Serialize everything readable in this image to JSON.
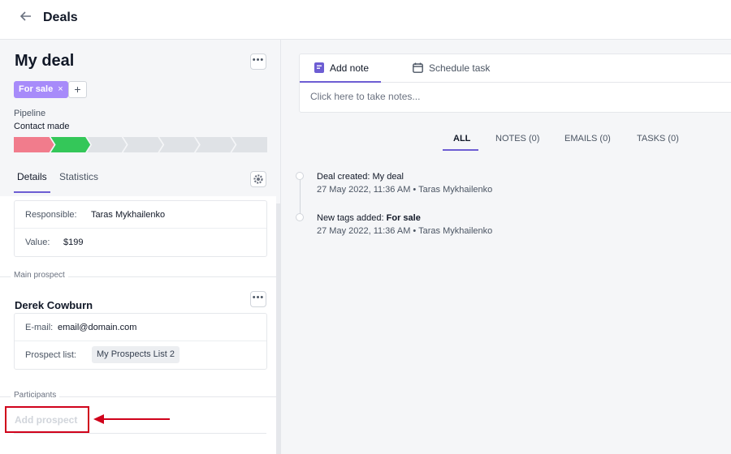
{
  "header": {
    "title": "Deals"
  },
  "deal": {
    "title": "My deal",
    "tag": "For sale",
    "tag_remove": "×",
    "tag_add": "+",
    "pipeline_label": "Pipeline",
    "pipeline_stage": "Contact made",
    "pipeline_colors": [
      "#f17c8c",
      "#34c759",
      "#dfe2e6",
      "#dfe2e6",
      "#dfe2e6",
      "#dfe2e6",
      "#dfe2e6"
    ]
  },
  "left_tabs": {
    "details": "Details",
    "statistics": "Statistics"
  },
  "details": {
    "responsible_label": "Responsible:",
    "responsible_value": "Taras Mykhailenko",
    "value_label": "Value:",
    "value_value": "$199"
  },
  "prospect": {
    "section_label": "Main prospect",
    "name": "Derek Cowburn",
    "email_label": "E-mail:",
    "email_value": "email@domain.com",
    "list_label": "Prospect list:",
    "list_value": "My Prospects List 2"
  },
  "participants": {
    "section_label": "Participants",
    "add_label": "Add prospect"
  },
  "notes": {
    "tab_note": "Add note",
    "tab_task": "Schedule task",
    "placeholder": "Click here to take notes..."
  },
  "filter_tabs": [
    "ALL",
    "NOTES (0)",
    "EMAILS (0)",
    "TASKS (0)"
  ],
  "activity": [
    {
      "title": "Deal created: My deal",
      "title_bold": "",
      "date": "27 May 2022, 11:36 AM",
      "author": "Taras Mykhailenko"
    },
    {
      "title": "New tags added: ",
      "title_bold": "For sale",
      "date": "27 May 2022, 11:36 AM",
      "author": "Taras Mykhailenko"
    }
  ],
  "colors": {
    "accent": "#6d5dd3",
    "tag": "#a78bfa",
    "highlight": "#d0021b"
  }
}
